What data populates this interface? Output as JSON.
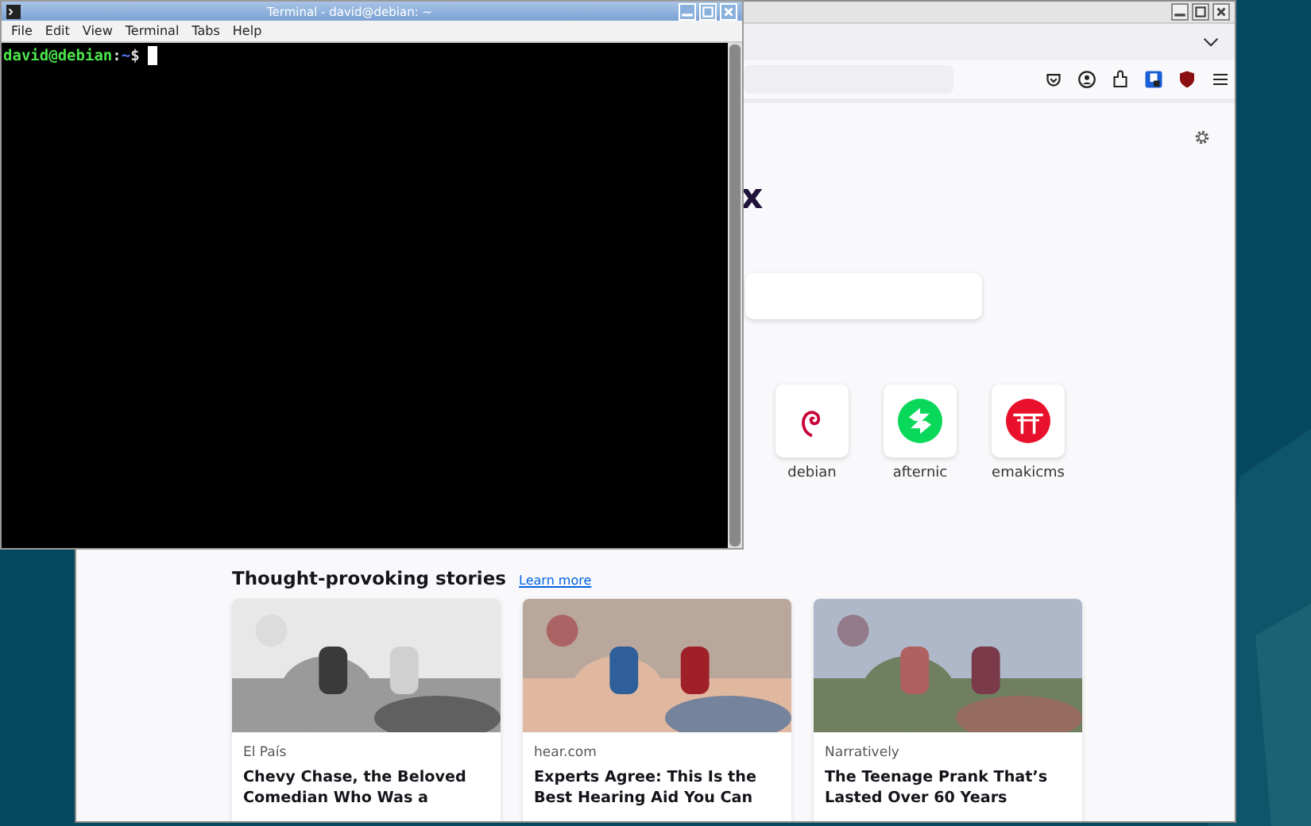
{
  "terminal": {
    "title": "Terminal - david@debian: ~",
    "menu": [
      "File",
      "Edit",
      "View",
      "Terminal",
      "Tabs",
      "Help"
    ],
    "prompt": {
      "user_host": "david@debian",
      "separator": ":",
      "path": "~",
      "symbol": "$"
    }
  },
  "browser": {
    "logo_text": "x",
    "shortcuts": [
      {
        "label": "debian",
        "kind": "debian"
      },
      {
        "label": "afternic",
        "kind": "afternic"
      },
      {
        "label": "emakicms",
        "kind": "emakicms"
      }
    ],
    "stories": {
      "heading": "Thought-provoking stories",
      "link": "Learn more",
      "cards": [
        {
          "source": "El País",
          "title": "Chevy Chase, the Beloved Comedian Who Was a"
        },
        {
          "source": "hear.com",
          "title": "Experts Agree: This Is the Best Hearing Aid You Can"
        },
        {
          "source": "Narratively",
          "title": "The Teenage Prank That’s Lasted Over 60 Years"
        }
      ]
    }
  }
}
